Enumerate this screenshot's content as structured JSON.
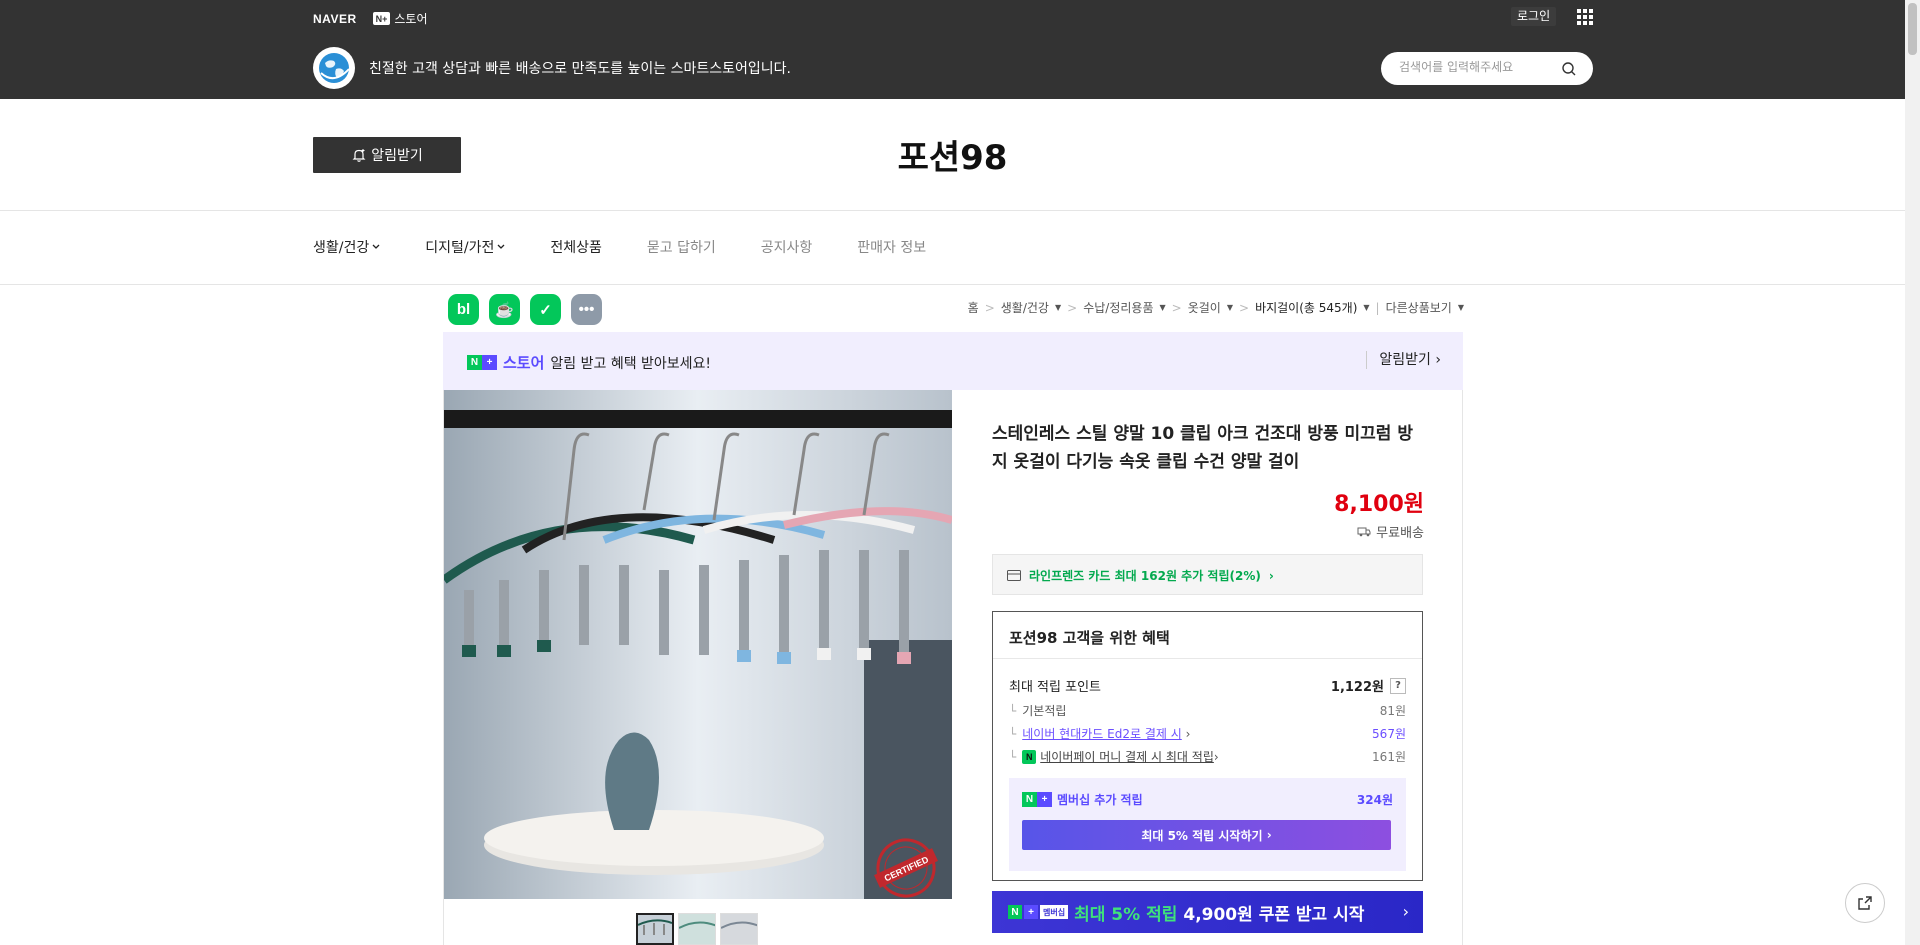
{
  "header": {
    "naver_logo": "NAVER",
    "nplus_mark": "N+",
    "store_label": "스토어",
    "login": "로그인",
    "store_description": "친절한 고객 상담과 빠른 배송으로 만족도를 높이는 스마트스토어입니다.",
    "search_placeholder": "검색어를 입력해주세요"
  },
  "store": {
    "alarm_button": "알림받기",
    "name": "포션98"
  },
  "categories": [
    {
      "label": "생활/건강",
      "dropdown": true
    },
    {
      "label": "디지털/가전",
      "dropdown": true
    },
    {
      "label": "전체상품",
      "dropdown": false
    },
    {
      "label": "묻고 답하기",
      "dropdown": false
    },
    {
      "label": "공지사항",
      "dropdown": false
    },
    {
      "label": "판매자 정보",
      "dropdown": false
    }
  ],
  "share_icons": [
    "blog-icon",
    "cafe-icon",
    "bookmark-icon",
    "more-icon"
  ],
  "share_icon_glyphs": [
    "bl",
    "☕",
    "✓",
    "•••"
  ],
  "breadcrumb": {
    "home": "홈",
    "c1": "생활/건강",
    "c2": "수납/정리용품",
    "c3": "옷걸이",
    "c4": "바지걸이(총 545개)",
    "other": "다른상품보기"
  },
  "alarm_banner": {
    "store": "스토어",
    "text": "알림 받고 혜택 받아보세요!",
    "action": "알림받기"
  },
  "product": {
    "title": "스테인레스 스틸 양말 10 클립 아크 건조대 방풍 미끄럼 방지 옷걸이 다기능 속옷 클립 수건 양말 걸이",
    "price": "8,100원",
    "shipping": "무료배송",
    "card_benefit": "라인프렌즈 카드 최대 162원 추가 적립(2%)",
    "stamp": "CERTIFIED",
    "thumbnail_count": 3
  },
  "benefits": {
    "title": "포션98 고객을 위한 혜택",
    "max_points_label": "최대 적립 포인트",
    "max_points_value": "1,122원",
    "help": "?",
    "rows": [
      {
        "label": "기본적립",
        "value": "81원"
      },
      {
        "label": "네이버 현대카드 Ed2로 결제 시",
        "value": "567원"
      },
      {
        "label": "네이버페이 머니 결제 시 최대 적립",
        "value": "161원"
      }
    ],
    "membership_label": "멤버십 추가 적립",
    "membership_value": "324원",
    "membership_cta": "최대 5% 적립 시작하기",
    "coupon_badge": "멤버십",
    "coupon_highlight": "최대 5% 적립",
    "coupon_text": "4,900원 쿠폰 받고 시작"
  },
  "colors": {
    "header_bg": "#333333",
    "price": "#e0000f",
    "naver_green": "#03c75a",
    "plus_purple": "#5b4bff"
  }
}
